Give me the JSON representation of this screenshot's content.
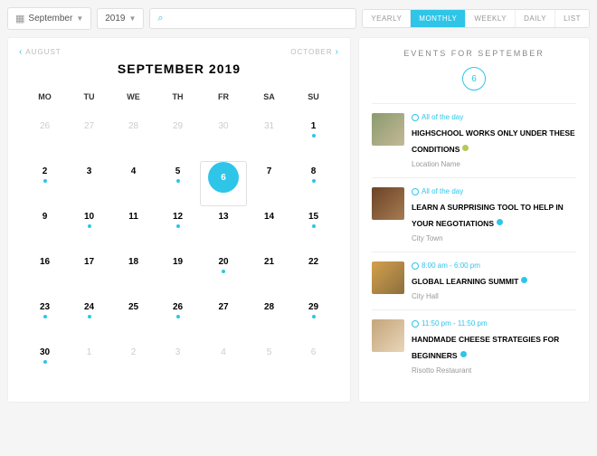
{
  "filters": {
    "month": "September",
    "year": "2019",
    "search_placeholder": ""
  },
  "views": [
    "YEARLY",
    "MONTHLY",
    "WEEKLY",
    "DAILY",
    "LIST"
  ],
  "active_view": "MONTHLY",
  "calendar": {
    "title": "SEPTEMBER 2019",
    "prev": "AUGUST",
    "next": "OCTOBER",
    "dow": [
      "MO",
      "TU",
      "WE",
      "TH",
      "FR",
      "SA",
      "SU"
    ],
    "cells": [
      {
        "n": 26,
        "out": true
      },
      {
        "n": 27,
        "out": true
      },
      {
        "n": 28,
        "out": true
      },
      {
        "n": 29,
        "out": true
      },
      {
        "n": 30,
        "out": true
      },
      {
        "n": 31,
        "out": true
      },
      {
        "n": 1,
        "dot": true
      },
      {
        "n": 2,
        "dot": true
      },
      {
        "n": 3
      },
      {
        "n": 4
      },
      {
        "n": 5,
        "dot": true
      },
      {
        "n": 6,
        "sel": true,
        "dot": true
      },
      {
        "n": 7
      },
      {
        "n": 8,
        "dot": true
      },
      {
        "n": 9
      },
      {
        "n": 10,
        "dot": true
      },
      {
        "n": 11
      },
      {
        "n": 12,
        "dot": true
      },
      {
        "n": 13
      },
      {
        "n": 14
      },
      {
        "n": 15,
        "dot": true
      },
      {
        "n": 16
      },
      {
        "n": 17
      },
      {
        "n": 18
      },
      {
        "n": 19
      },
      {
        "n": 20,
        "dot": true
      },
      {
        "n": 21
      },
      {
        "n": 22
      },
      {
        "n": 23,
        "dot": true
      },
      {
        "n": 24,
        "dot": true
      },
      {
        "n": 25
      },
      {
        "n": 26,
        "dot": true
      },
      {
        "n": 27
      },
      {
        "n": 28
      },
      {
        "n": 29,
        "dot": true
      },
      {
        "n": 30,
        "dot": true
      },
      {
        "n": 1,
        "out": true
      },
      {
        "n": 2,
        "out": true
      },
      {
        "n": 3,
        "out": true
      },
      {
        "n": 4,
        "out": true
      },
      {
        "n": 5,
        "out": true
      },
      {
        "n": 6,
        "out": true
      }
    ]
  },
  "events_header": "EVENTS FOR SEPTEMBER",
  "selected_day": "6",
  "events": [
    {
      "time": "All of the day",
      "title": "HIGHSCHOOL WORKS ONLY UNDER THESE CONDITIONS",
      "loc": "Location Name",
      "badge": "#b5c954",
      "thumb": "t1"
    },
    {
      "time": "All of the day",
      "title": "LEARN A SURPRISING TOOL TO HELP IN YOUR NEGOTIATIONS",
      "loc": "City Town",
      "badge": "#2EC5E8",
      "thumb": "t2"
    },
    {
      "time": "8:00 am - 6:00 pm",
      "title": "GLOBAL LEARNING SUMMIT",
      "loc": "City Hall",
      "badge": "#2EC5E8",
      "thumb": "t3"
    },
    {
      "time": "11:50 pm - 11:50 pm",
      "title": "HANDMADE CHEESE STRATEGIES FOR BEGINNERS",
      "loc": "Risotto Restaurant",
      "badge": "#2EC5E8",
      "thumb": "t4"
    }
  ]
}
